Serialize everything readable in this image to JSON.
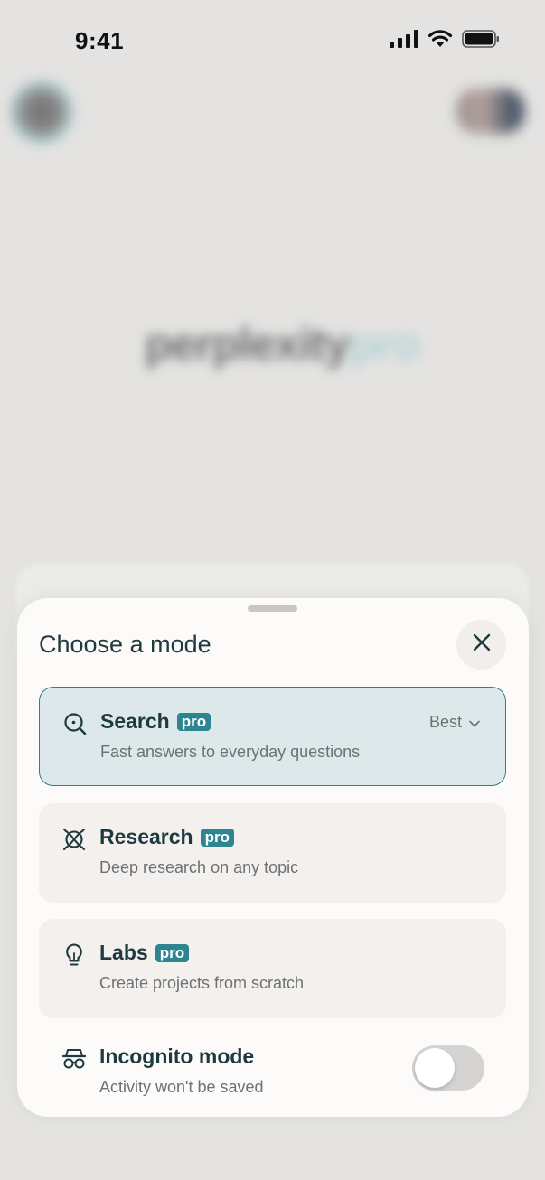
{
  "status_bar": {
    "time": "9:41",
    "icons": [
      "signal-icon",
      "wifi-icon",
      "battery-icon"
    ]
  },
  "background": {
    "logo_text": "perplexity",
    "logo_badge": "pro"
  },
  "sheet": {
    "title": "Choose a mode",
    "close_icon": "close-icon",
    "modes": [
      {
        "name": "Search",
        "badge": "pro",
        "description": "Fast answers to everyday questions",
        "icon": "search-icon",
        "selected": true,
        "model_select": "Best"
      },
      {
        "name": "Research",
        "badge": "pro",
        "description": "Deep research on any topic",
        "icon": "research-icon",
        "selected": false
      },
      {
        "name": "Labs",
        "badge": "pro",
        "description": "Create projects from scratch",
        "icon": "lightbulb-icon",
        "selected": false
      }
    ],
    "incognito": {
      "name": "Incognito mode",
      "description": "Activity won't be saved",
      "icon": "incognito-icon",
      "enabled": false
    }
  },
  "colors": {
    "accent": "#2d8592",
    "selected_bg": "#dde8ea",
    "card_bg": "#f3f0ee",
    "text_primary": "#1f3a3f",
    "text_secondary": "#6b7174"
  }
}
